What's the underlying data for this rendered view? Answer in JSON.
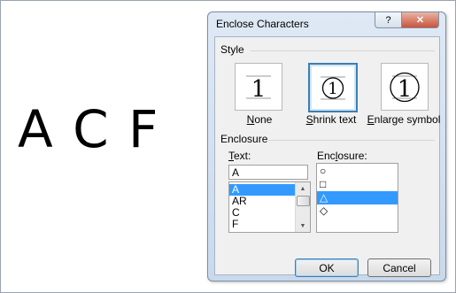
{
  "document": {
    "text": "A C F"
  },
  "dialog": {
    "title": "Enclose Characters",
    "help_glyph": "?",
    "close_glyph": "✕",
    "style_section": "Style",
    "styles": [
      {
        "label": "None",
        "accel": "N",
        "rest": "one",
        "sample": "1"
      },
      {
        "label": "Shrink text",
        "accel": "S",
        "rest": "hrink text",
        "sample": "1"
      },
      {
        "label": "Enlarge symbol",
        "accel": "E",
        "rest": "nlarge symbol",
        "sample": "1"
      }
    ],
    "selected_style": "Shrink text",
    "enclosure_section": "Enclosure",
    "text_label": "Text:",
    "text_label_accel": "T",
    "text_label_rest": "ext:",
    "text_value": "A",
    "text_items": [
      "A",
      "AR",
      "C",
      "F"
    ],
    "selected_text": "A",
    "enclosure_label": "Enclosure:",
    "enclosure_label_pre": "Enc",
    "enclosure_label_accel": "l",
    "enclosure_label_rest": "osure:",
    "enclosure_items": [
      "○",
      "□",
      "△",
      "◇"
    ],
    "selected_enclosure": "△",
    "ok_label": "OK",
    "cancel_label": "Cancel"
  },
  "colors": {
    "selection": "#3399ff",
    "accent": "#3c7fb1"
  }
}
